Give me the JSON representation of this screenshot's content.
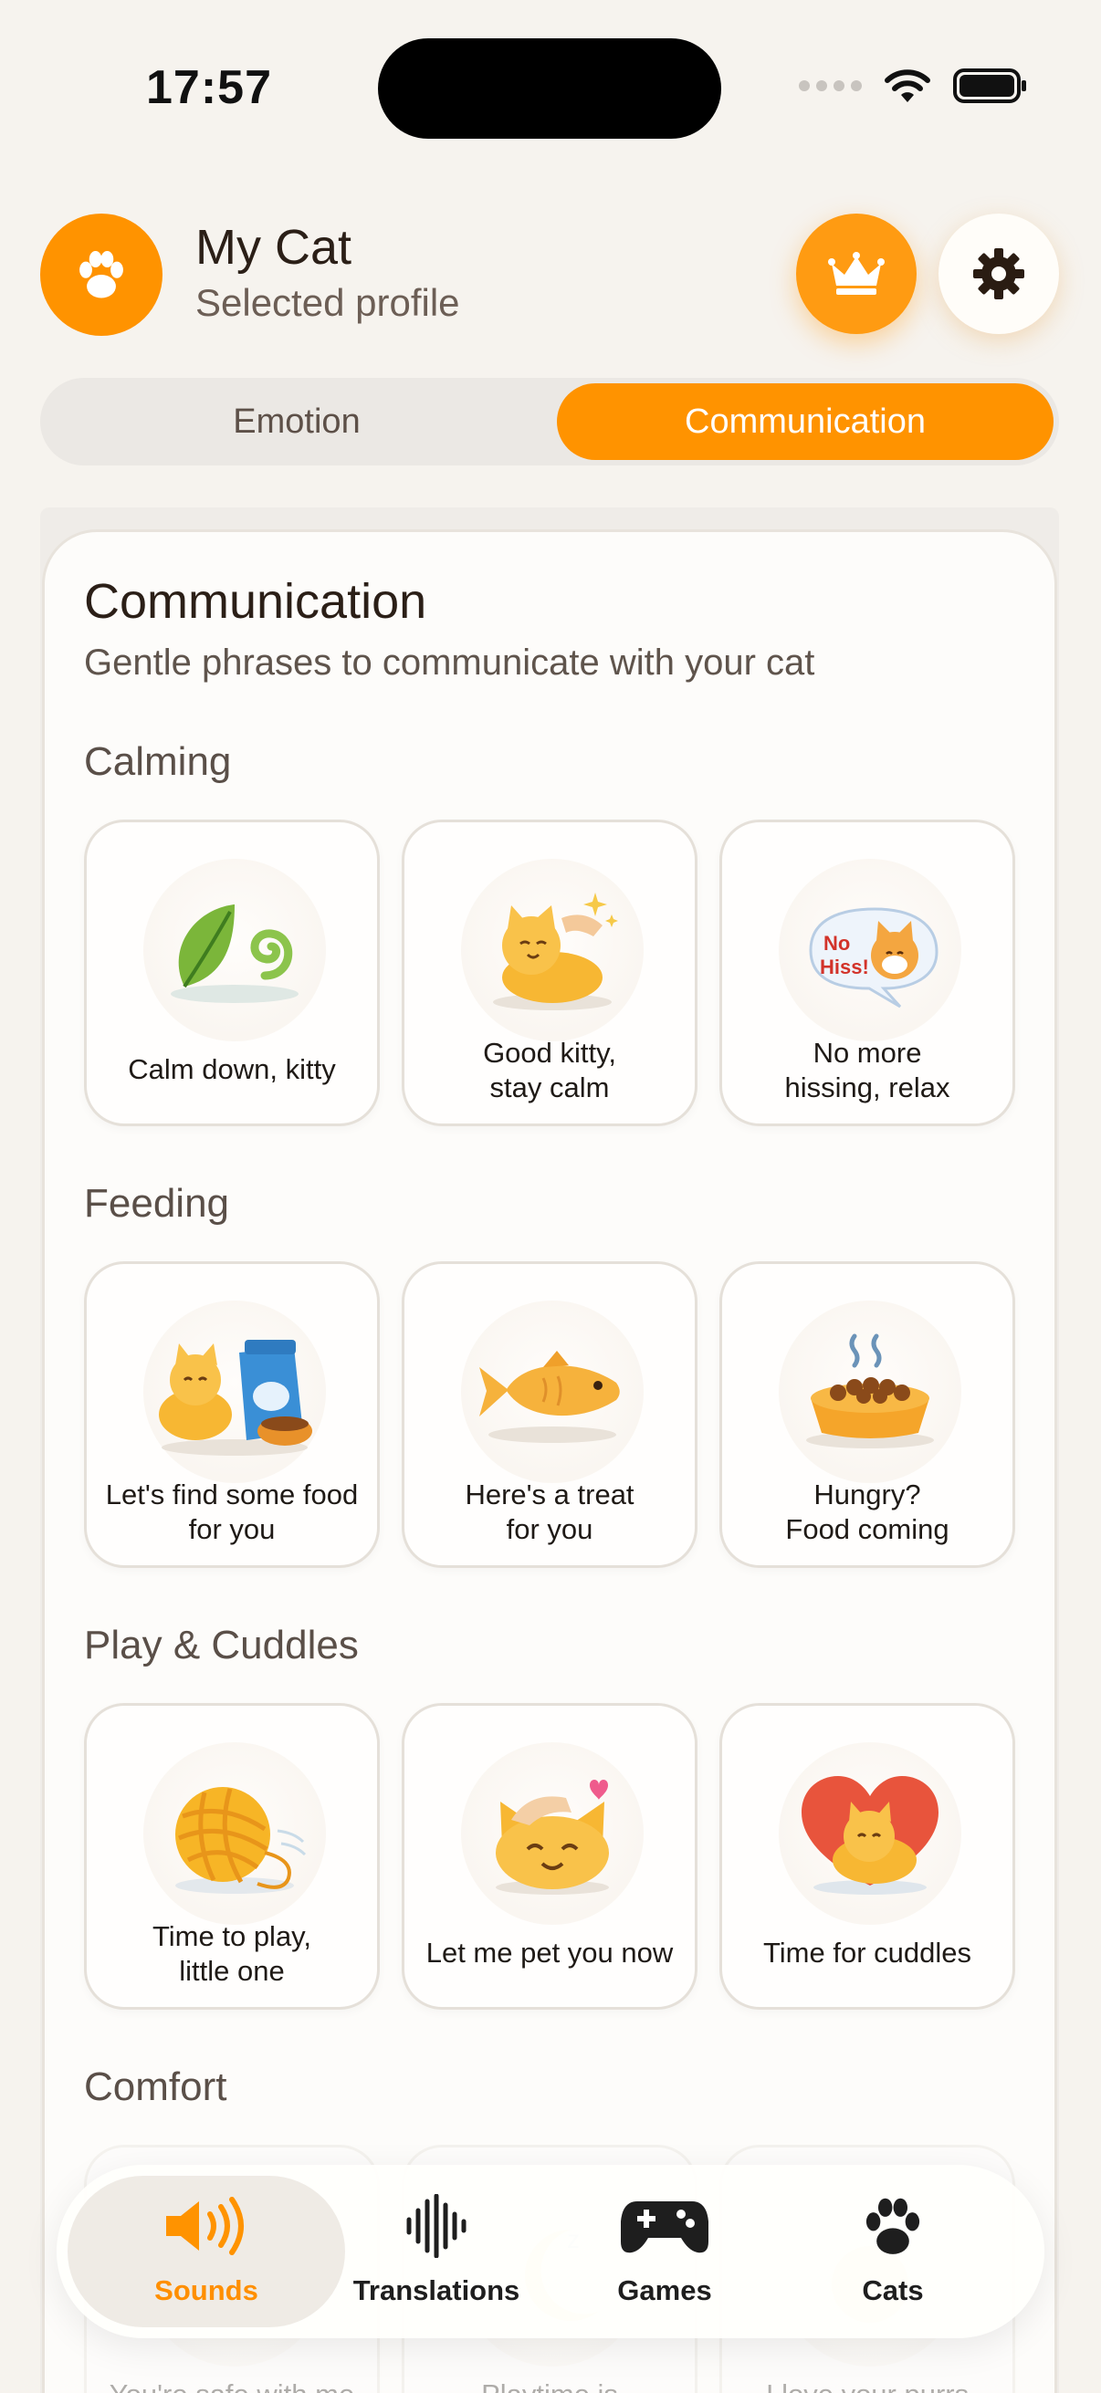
{
  "status_bar": {
    "time": "17:57"
  },
  "header": {
    "profile_name": "My Cat",
    "profile_subtitle": "Selected profile"
  },
  "tabs": [
    {
      "label": "Emotion",
      "selected": false
    },
    {
      "label": "Communication",
      "selected": true
    }
  ],
  "card": {
    "title": "Communication",
    "subtitle": "Gentle phrases to communicate with your cat"
  },
  "sections": [
    {
      "title": "Calming",
      "items": [
        {
          "label": "Calm down, kitty",
          "icon": "leaf-icon"
        },
        {
          "label": "Good kitty,\nstay calm",
          "icon": "sparkle-cat-icon"
        },
        {
          "label": "No more\nhissing, relax",
          "icon": "no-hiss-bubble-icon",
          "bubble_text": "No Hiss!"
        }
      ]
    },
    {
      "title": "Feeding",
      "items": [
        {
          "label": "Let's find some food\nfor you",
          "icon": "cat-food-bag-icon"
        },
        {
          "label": "Here's a treat\nfor you",
          "icon": "fish-treat-icon"
        },
        {
          "label": "Hungry?\nFood coming",
          "icon": "food-bowl-icon"
        }
      ]
    },
    {
      "title": "Play & Cuddles",
      "items": [
        {
          "label": "Time to play,\nlittle one",
          "icon": "yarn-ball-icon"
        },
        {
          "label": "Let me pet you now",
          "icon": "petting-cat-icon"
        },
        {
          "label": "Time for cuddles",
          "icon": "heart-cat-icon"
        }
      ]
    },
    {
      "title": "Comfort",
      "items": [
        {
          "label": "You're safe with me",
          "icon": "sun-cat-icon"
        },
        {
          "label": "Playtime is",
          "icon": "moon-icon"
        },
        {
          "label": "I love your purrs",
          "icon": "glow-cat-icon"
        }
      ]
    }
  ],
  "bottom_nav": [
    {
      "label": "Sounds",
      "icon": "speaker-icon",
      "active": true
    },
    {
      "label": "Translations",
      "icon": "waveform-icon",
      "active": false
    },
    {
      "label": "Games",
      "icon": "gamepad-icon",
      "active": false
    },
    {
      "label": "Cats",
      "icon": "paw-icon",
      "active": false
    }
  ],
  "colors": {
    "accent": "#FF9300",
    "background": "#F6F3EE",
    "active_nav_label": "#FF8F00"
  }
}
